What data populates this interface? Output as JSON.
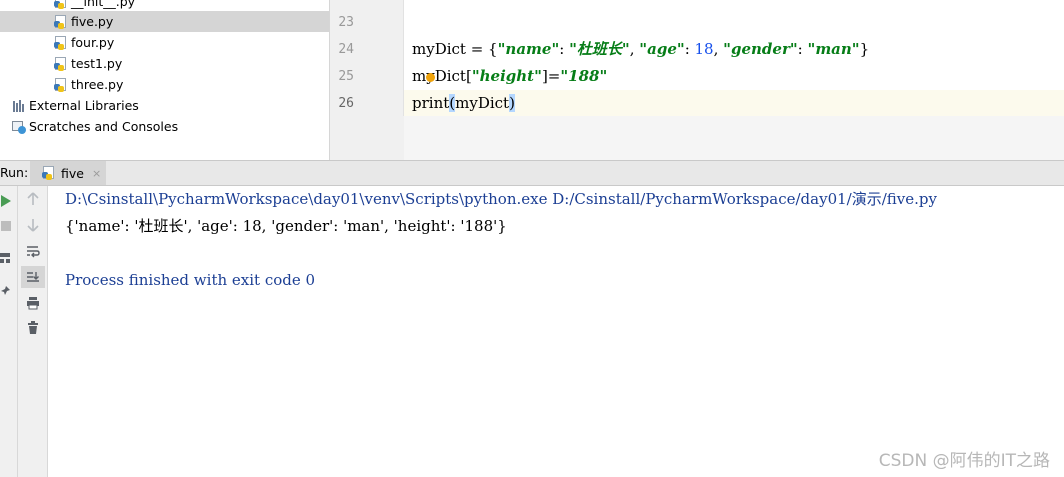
{
  "project_tree": {
    "items": [
      {
        "label": "__init__.py",
        "icon": "python-file-icon"
      },
      {
        "label": "five.py",
        "icon": "python-file-icon",
        "selected": true
      },
      {
        "label": "four.py",
        "icon": "python-file-icon"
      },
      {
        "label": "test1.py",
        "icon": "python-file-icon"
      },
      {
        "label": "three.py",
        "icon": "python-file-icon"
      },
      {
        "label": "External Libraries",
        "icon": "library-icon"
      },
      {
        "label": "Scratches and Consoles",
        "icon": "scratches-icon"
      }
    ]
  },
  "editor": {
    "lines": [
      {
        "number": "23"
      },
      {
        "number": "24",
        "parts": {
          "a": "myDict = {",
          "k1": "\"name\"",
          "c1": ": ",
          "v1": "\"杜班长\"",
          "c2": ", ",
          "k2": "\"age\"",
          "c3": ": ",
          "v2": "18",
          "c4": ", ",
          "k3": "\"gender\"",
          "c5": ": ",
          "v3": "\"man\"",
          "e": "}"
        }
      },
      {
        "number": "25",
        "parts": {
          "a": "m",
          "b": "yDict[",
          "k": "\"height\"",
          "c": "]=",
          "v": "\"188\""
        }
      },
      {
        "number": "26",
        "parts": {
          "a": "print",
          "b": "(",
          "c": "myDict",
          "d": ")"
        }
      }
    ]
  },
  "run": {
    "label": "Run:",
    "tab_label": "five",
    "tab_close": "×",
    "icons": {
      "rerun": "play-icon",
      "stop": "stop-icon",
      "up": "arrow-up-icon",
      "down": "arrow-down-icon",
      "wrap": "soft-wrap-icon",
      "scroll": "scroll-to-end-icon",
      "print": "print-icon",
      "trash": "trash-icon",
      "pin": "pin-icon",
      "layout": "layout-icon"
    },
    "colors": {
      "play": "#499c54"
    }
  },
  "console": {
    "lines": [
      "D:\\Csinstall\\PycharmWorkspace\\day01\\venv\\Scripts\\python.exe D:/Csinstall/PycharmWorkspace/day01/演示/five.py",
      "{'name': '杜班长', 'age': 18, 'gender': 'man', 'height': '188'}",
      "",
      "Process finished with exit code 0"
    ]
  },
  "watermark": "CSDN @阿伟的IT之路"
}
